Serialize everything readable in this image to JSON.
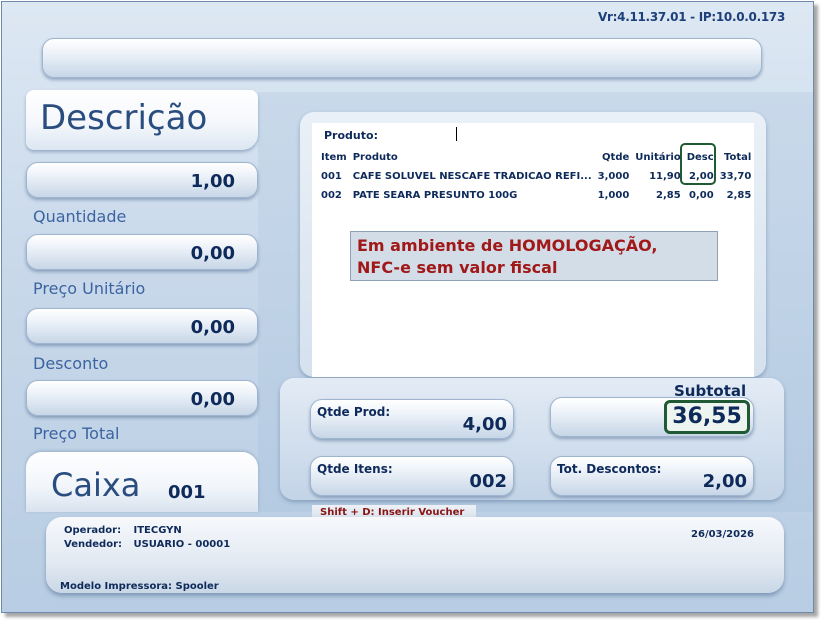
{
  "header": {
    "version": "Vr:4.11.37.01 - IP:10.0.0.173"
  },
  "left": {
    "title": "Descrição",
    "fields": [
      {
        "label": "Quantidade",
        "value": "1,00"
      },
      {
        "label": "Preço Unitário",
        "value": "0,00"
      },
      {
        "label": "Desconto",
        "value": "0,00"
      },
      {
        "label": "Preço Total",
        "value": "0,00"
      }
    ],
    "caixa_label": "Caixa",
    "caixa_number": "001"
  },
  "items": {
    "produto_label": "Produto:",
    "columns": [
      "Item",
      "Produto",
      "Qtde",
      "Unitário",
      "Desc",
      "Total"
    ],
    "rows": [
      {
        "item": "001",
        "produto": "CAFE SOLUVEL NESCAFE TRADICAO REFI...",
        "qtde": "3,000",
        "unitario": "11,90",
        "desc": "2,00",
        "total": "33,70"
      },
      {
        "item": "002",
        "produto": "PATE SEARA PRESUNTO 100G",
        "qtde": "1,000",
        "unitario": "2,85",
        "desc": "0,00",
        "total": "2,85"
      }
    ],
    "warning_line1": "Em ambiente de HOMOLOGAÇÃO,",
    "warning_line2": "NFC-e sem valor fiscal"
  },
  "totals": {
    "qtde_prod_label": "Qtde Prod:",
    "qtde_prod_value": "4,00",
    "qtde_itens_label": "Qtde Itens:",
    "qtde_itens_value": "002",
    "subtotal_label": "Subtotal",
    "subtotal_value": "36,55",
    "tot_descontos_label": "Tot. Descontos:",
    "tot_descontos_value": "2,00"
  },
  "hint": "Shift + D: Inserir Voucher",
  "footer": {
    "operador_label": "Operador:",
    "operador_value": "ITECGYN",
    "vendedor_label": "Vendedor:",
    "vendedor_value": "USUARIO - 00001",
    "date": "26/03/2026",
    "impressora_label": "Modelo Impressora:",
    "impressora_value": "Spooler"
  },
  "colors": {
    "accent_text": "#0e2a5a",
    "warning_text": "#a01818",
    "highlight_border": "#1f5a34"
  }
}
